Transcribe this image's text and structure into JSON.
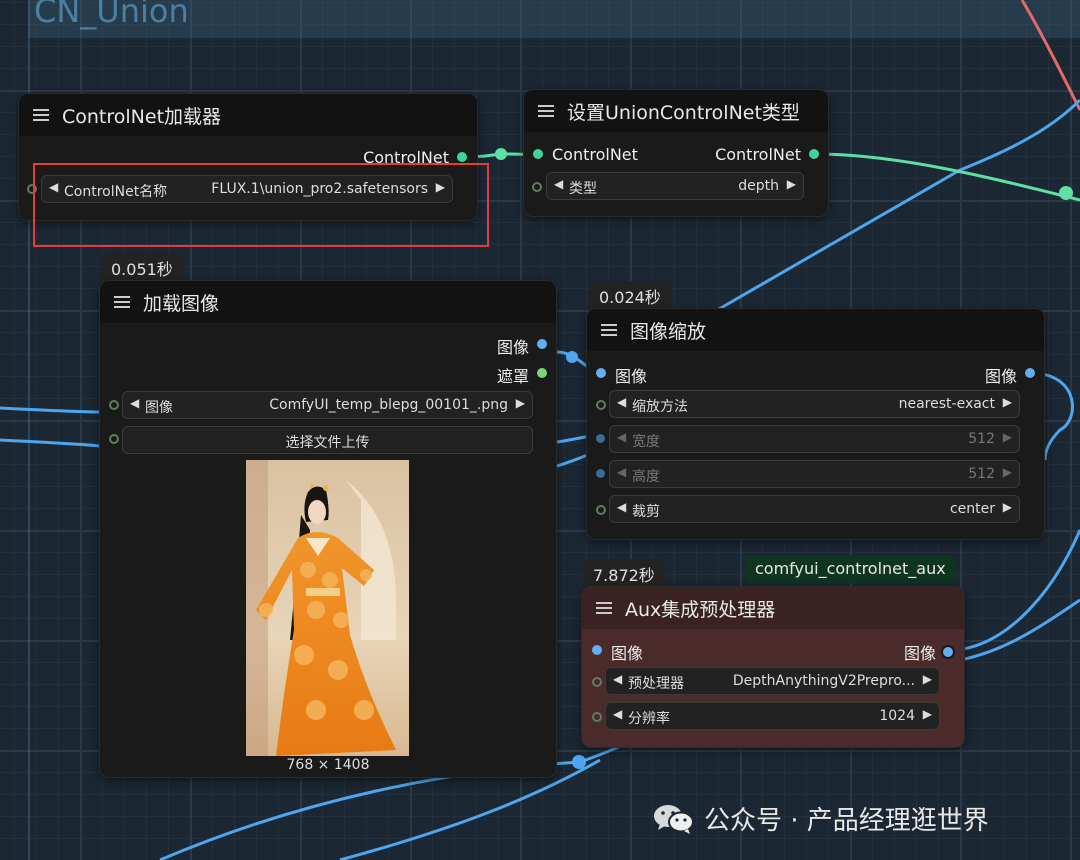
{
  "group": {
    "title": "CN_Union"
  },
  "nodes": {
    "controlnet_loader": {
      "title": "ControlNet加载器",
      "output_label": "ControlNet",
      "widget": {
        "label": "ControlNet名称",
        "value": "FLUX.1\\union_pro2.safetensors"
      }
    },
    "union_type": {
      "title": "设置UnionControlNet类型",
      "input_label": "ControlNet",
      "output_label": "ControlNet",
      "widget": {
        "label": "类型",
        "value": "depth"
      }
    },
    "load_image": {
      "timing": "0.051秒",
      "title": "加载图像",
      "output_image": "图像",
      "output_mask": "遮罩",
      "widget": {
        "label": "图像",
        "value": "ComfyUI_temp_blepg_00101_.png"
      },
      "upload_label": "选择文件上传",
      "image_size": "768 × 1408"
    },
    "image_scale": {
      "timing": "0.024秒",
      "title": "图像缩放",
      "input_label": "图像",
      "output_label": "图像",
      "widgets": [
        {
          "label": "缩放方法",
          "value": "nearest-exact"
        },
        {
          "label": "宽度",
          "value": "512"
        },
        {
          "label": "高度",
          "value": "512"
        },
        {
          "label": "裁剪",
          "value": "center"
        }
      ]
    },
    "aux": {
      "timing": "7.872秒",
      "badge": "comfyui_controlnet_aux",
      "title": "Aux集成预处理器",
      "input_label": "图像",
      "output_label": "图像",
      "widgets": [
        {
          "label": "预处理器",
          "value": "DepthAnythingV2Prepro..."
        },
        {
          "label": "分辨率",
          "value": "1024"
        }
      ]
    }
  },
  "watermark": {
    "text": "公众号 · 产品经理逛世界"
  },
  "colors": {
    "controlnet_wire": "#5ee0a3",
    "image_wire": "#4ea6ee",
    "red_wire": "#e46a6a",
    "highlight": "#e53b3b",
    "aux_node": "#4a2a2a"
  }
}
